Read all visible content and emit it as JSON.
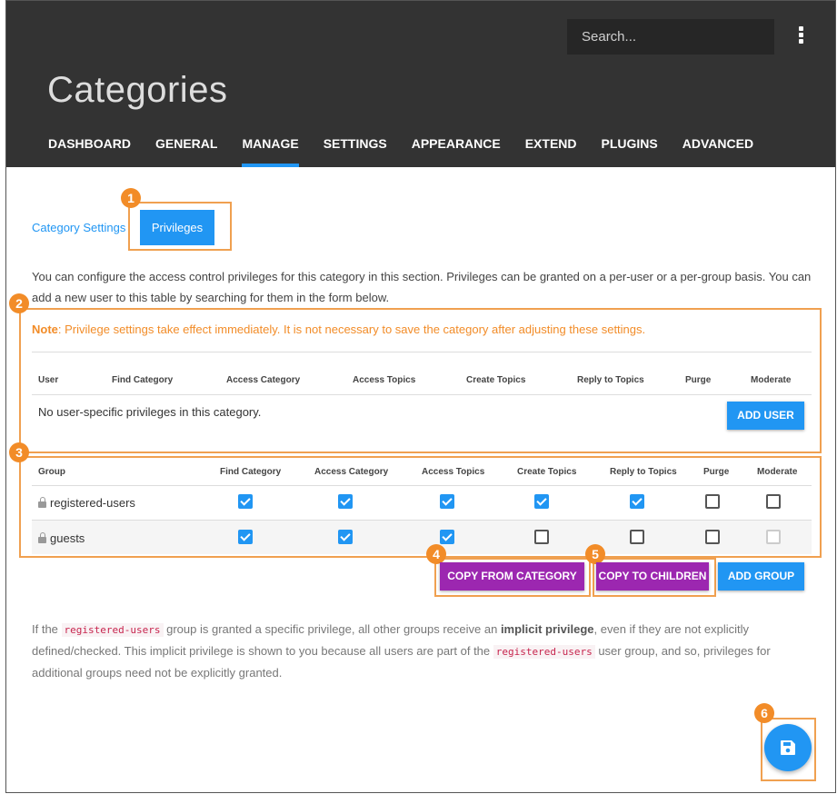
{
  "header": {
    "search_placeholder": "Search...",
    "title": "Categories",
    "nav": [
      "DASHBOARD",
      "GENERAL",
      "MANAGE",
      "SETTINGS",
      "APPEARANCE",
      "EXTEND",
      "PLUGINS",
      "ADVANCED"
    ],
    "active_nav": "MANAGE"
  },
  "tabs": {
    "settings": "Category Settings",
    "privileges": "Privileges"
  },
  "description": "You can configure the access control privileges for this category in this section. Privileges can be granted on a per-user or a per-group basis. You can add a new user to this table by searching for them in the form below.",
  "note": {
    "label": "Note",
    "text": ": Privilege settings take effect immediately. It is not necessary to save the category after adjusting these settings."
  },
  "user_table": {
    "headers": [
      "User",
      "Find Category",
      "Access Category",
      "Access Topics",
      "Create Topics",
      "Reply to Topics",
      "Purge",
      "Moderate"
    ],
    "empty": "No user-specific privileges in this category.",
    "add_button": "ADD USER"
  },
  "group_table": {
    "headers": [
      "Group",
      "Find Category",
      "Access Category",
      "Access Topics",
      "Create Topics",
      "Reply to Topics",
      "Purge",
      "Moderate"
    ],
    "rows": [
      {
        "name": "registered-users",
        "privileges": [
          "on",
          "on",
          "on",
          "on",
          "on",
          "off",
          "off"
        ]
      },
      {
        "name": "guests",
        "privileges": [
          "on",
          "on",
          "on",
          "off",
          "off",
          "off",
          "disabled"
        ]
      }
    ]
  },
  "buttons": {
    "copy_from": "COPY FROM CATEGORY",
    "copy_to": "COPY TO CHILDREN",
    "add_group": "ADD GROUP"
  },
  "explanation": {
    "p1": "If the ",
    "code1": "registered-users",
    "p2": " group is granted a specific privilege, all other groups receive an ",
    "bold": "implicit privilege",
    "p3": ", even if they are not explicitly defined/checked. This implicit privilege is shown to you because all users are part of the ",
    "code2": "registered-users",
    "p4": " user group, and so, privileges for additional groups need not be explicitly granted."
  },
  "annotations": [
    "1",
    "2",
    "3",
    "4",
    "5",
    "6"
  ],
  "colors": {
    "primary": "#2196f3",
    "purple": "#9c27b0",
    "annotation": "#f28c28",
    "header": "#333333"
  }
}
